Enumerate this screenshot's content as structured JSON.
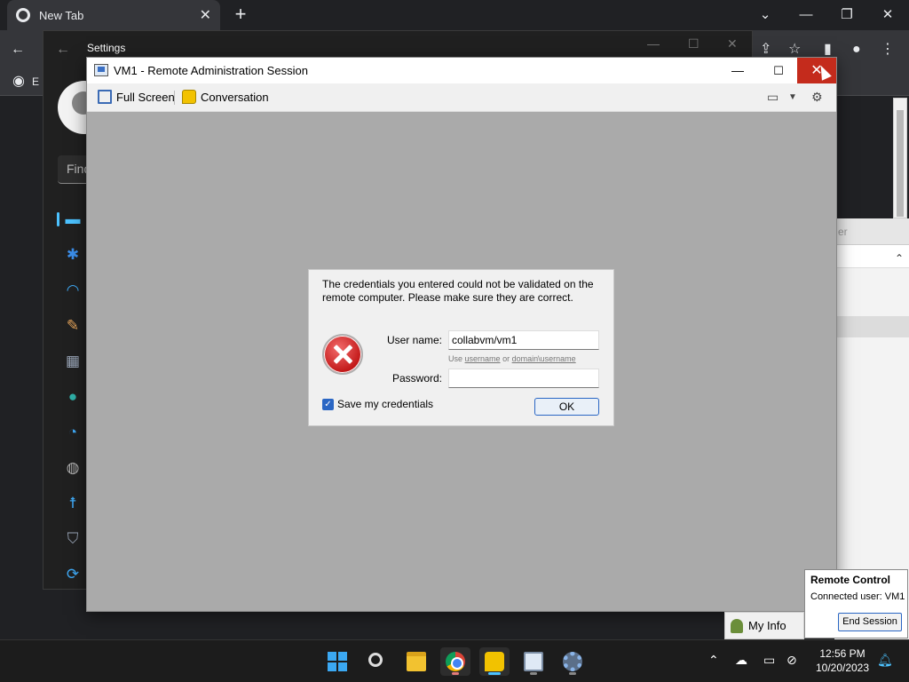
{
  "chrome": {
    "tab_title": "New Tab",
    "tab_close": "✕",
    "new_tab": "+",
    "bookmark_partial": "E",
    "win_dropdown": "⌄",
    "win_minimize": "—",
    "win_restore": "❐",
    "win_close": "✕"
  },
  "settings": {
    "title": "Settings",
    "find_placeholder": "Find",
    "partial_text": "er"
  },
  "rdp": {
    "title": "VM1 - Remote Administration Session",
    "minimize": "—",
    "maximize": "☐",
    "close": "✕",
    "toolbar": {
      "fullscreen_label": "Full Screen",
      "conversation_label": "Conversation"
    }
  },
  "credentials": {
    "message": "The credentials you entered could not be validated on the remote computer. Please make sure they are correct.",
    "username_label": "User name:",
    "username_value": "collabvm/vm1",
    "hint_prefix": "Use",
    "hint_username": "username",
    "hint_or": "or",
    "hint_domain": "domain\\username",
    "password_label": "Password:",
    "password_value": "",
    "save_label": "Save my credentials",
    "save_checked": true,
    "ok_label": "OK"
  },
  "remote_control": {
    "title": "Remote Control",
    "connected_user": "Connected user:  VM1",
    "end_session": "End Session"
  },
  "myinfo": {
    "label": "My Info"
  },
  "taskbar": {
    "time": "12:56 PM",
    "date": "10/20/2023"
  },
  "colors": {
    "rdp_close": "#c42b1c",
    "accent": "#2a66c4",
    "canvas": "#aaaaaa"
  }
}
